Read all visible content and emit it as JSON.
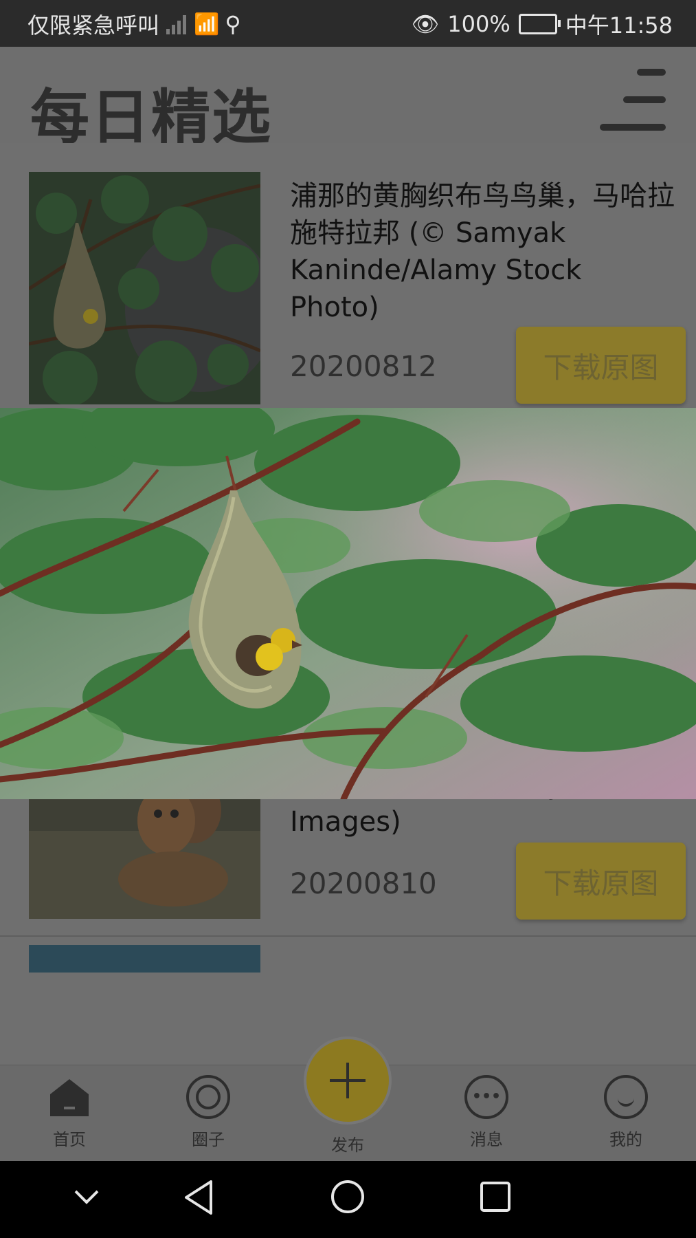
{
  "status_bar": {
    "emergency_text": "仅限紧急呼叫",
    "battery_percent": "100%",
    "time": "中午11:58"
  },
  "header": {
    "title": "每日精选"
  },
  "items": [
    {
      "caption": "浦那的黄胸织布鸟鸟巢，马哈拉施特拉邦 (© Samyak Kaninde/Alamy Stock Photo)",
      "date": "20200812",
      "download_label": "下载原图"
    },
    {
      "caption": "幼崽，博茨瓦纳卡拉哈里沙漠 (© Jami Tarris/Getty Images)",
      "date": "20200810",
      "download_label": "下载原图"
    }
  ],
  "bottom_nav": {
    "items": [
      {
        "label": "首页",
        "icon": "home-icon"
      },
      {
        "label": "圈子",
        "icon": "circle-icon"
      },
      {
        "label": "发布",
        "icon": "plus-icon"
      },
      {
        "label": "消息",
        "icon": "message-icon"
      },
      {
        "label": "我的",
        "icon": "profile-icon"
      }
    ]
  },
  "colors": {
    "accent": "#8d7a20",
    "overlay_gray": "#6f6f6f"
  }
}
